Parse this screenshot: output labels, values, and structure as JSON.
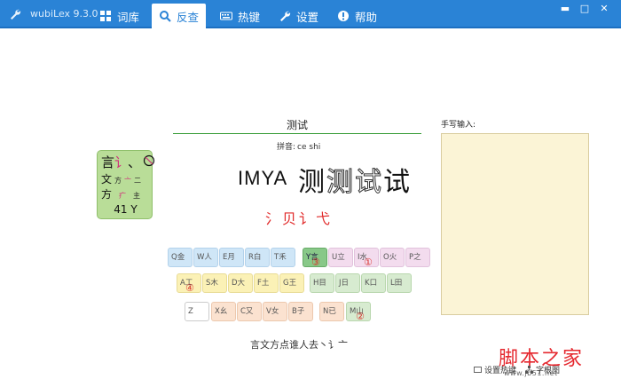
{
  "app": {
    "title": "wubiLex 9.3.0"
  },
  "tabs": [
    {
      "label": "词库",
      "icon": "grid-icon"
    },
    {
      "label": "反查",
      "icon": "search-icon"
    },
    {
      "label": "热键",
      "icon": "keyboard-icon"
    },
    {
      "label": "设置",
      "icon": "wrench-icon"
    },
    {
      "label": "帮助",
      "icon": "info-icon"
    }
  ],
  "window_controls": {
    "minimize": "▬",
    "maximize": "□",
    "close": "✕"
  },
  "result": {
    "title": "测试",
    "pinyin_label": "拼音:",
    "pinyin": "ce shi",
    "code": "IMYA",
    "chars": [
      "测",
      "测",
      "试",
      "试"
    ],
    "roots_red": "氵贝讠弋"
  },
  "code_card": {
    "row1": {
      "big": "言",
      "rest": "讠",
      "tail": "、"
    },
    "row2": {
      "a": "文",
      "b": "方",
      "c": "亠",
      "d": "二"
    },
    "row3": {
      "a": "方",
      "b": "疒",
      "c": "主"
    },
    "footer": "41 Y"
  },
  "keyboard": {
    "row1": [
      {
        "label": "Q金",
        "style": "blue"
      },
      {
        "label": "W人",
        "style": "blue"
      },
      {
        "label": "E月",
        "style": "blue"
      },
      {
        "label": "R白",
        "style": "blue"
      },
      {
        "label": "T禾",
        "style": "blue"
      },
      {
        "label": "Y言",
        "style": "active",
        "mark": "③"
      },
      {
        "label": "U立",
        "style": "pink"
      },
      {
        "label": "I水",
        "style": "pink",
        "mark": "①"
      },
      {
        "label": "O火",
        "style": "pink"
      },
      {
        "label": "P之",
        "style": "pink"
      }
    ],
    "row2": [
      {
        "label": "A工",
        "style": "yellow",
        "mark": "④"
      },
      {
        "label": "S木",
        "style": "yellow"
      },
      {
        "label": "D大",
        "style": "yellow"
      },
      {
        "label": "F土",
        "style": "yellow"
      },
      {
        "label": "G王",
        "style": "yellow"
      },
      {
        "label": "H目",
        "style": "green"
      },
      {
        "label": "J日",
        "style": "green"
      },
      {
        "label": "K口",
        "style": "green"
      },
      {
        "label": "L田",
        "style": "green"
      }
    ],
    "row3": [
      {
        "label": "Z",
        "style": "white"
      },
      {
        "label": "X幺",
        "style": "peach"
      },
      {
        "label": "C又",
        "style": "peach"
      },
      {
        "label": "V女",
        "style": "peach"
      },
      {
        "label": "B子",
        "style": "peach"
      },
      {
        "label": "N已",
        "style": "peach"
      },
      {
        "label": "M山",
        "style": "green",
        "mark": "②"
      }
    ]
  },
  "roots_line": "言文方点谁人去丶讠亠",
  "handwriting": {
    "label": "手写输入:"
  },
  "footer": {
    "hotkey": "设置热键",
    "tree": "字根图"
  },
  "watermark": {
    "big": "脚本之家",
    "url": "www.jb51.net"
  }
}
